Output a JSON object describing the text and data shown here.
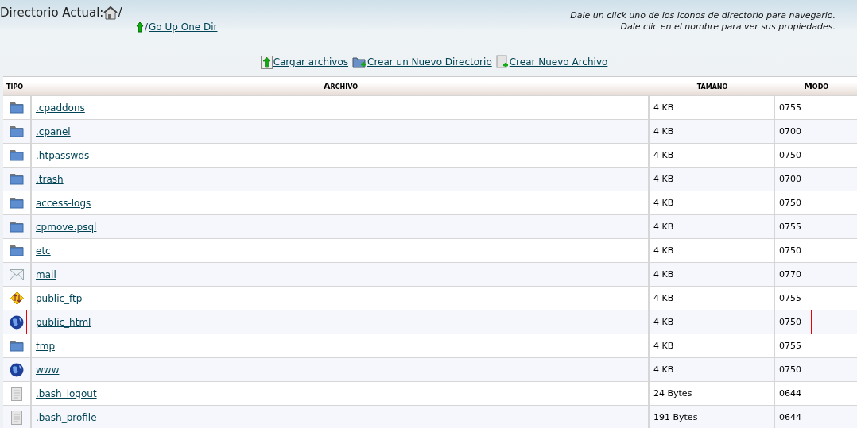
{
  "current_dir": {
    "label": "Directorio Actual:",
    "path": "/"
  },
  "go_up": {
    "separator": "/",
    "label": "Go Up One Dir"
  },
  "hints": [
    "Dale un click uno de los iconos de directorio para navegarlo.",
    "Dale clic en el nombre para ver sus propiedades."
  ],
  "actions": [
    {
      "kind": "upload",
      "label": "Cargar archivos"
    },
    {
      "kind": "newdir",
      "label": "Crear un Nuevo Directorio"
    },
    {
      "kind": "newfile",
      "label": "Crear Nuevo Archivo"
    }
  ],
  "table": {
    "columns": [
      "tipo",
      "Archivo",
      "tamaño",
      "Modo"
    ],
    "rows": [
      {
        "kind": "folder",
        "name": ".cpaddons",
        "size": "4 KB",
        "mode": "0755",
        "highlighted": false
      },
      {
        "kind": "folder",
        "name": ".cpanel",
        "size": "4 KB",
        "mode": "0700",
        "highlighted": false
      },
      {
        "kind": "folder",
        "name": ".htpasswds",
        "size": "4 KB",
        "mode": "0750",
        "highlighted": false
      },
      {
        "kind": "folder",
        "name": ".trash",
        "size": "4 KB",
        "mode": "0700",
        "highlighted": false
      },
      {
        "kind": "folder",
        "name": "access-logs",
        "size": "4 KB",
        "mode": "0750",
        "highlighted": false
      },
      {
        "kind": "folder",
        "name": "cpmove.psql",
        "size": "4 KB",
        "mode": "0755",
        "highlighted": false
      },
      {
        "kind": "folder",
        "name": "etc",
        "size": "4 KB",
        "mode": "0750",
        "highlighted": false
      },
      {
        "kind": "mail",
        "name": "mail",
        "size": "4 KB",
        "mode": "0770",
        "highlighted": false
      },
      {
        "kind": "ftp",
        "name": "public_ftp",
        "size": "4 KB",
        "mode": "0755",
        "highlighted": false
      },
      {
        "kind": "web",
        "name": "public_html",
        "size": "4 KB",
        "mode": "0750",
        "highlighted": true
      },
      {
        "kind": "folder",
        "name": "tmp",
        "size": "4 KB",
        "mode": "0755",
        "highlighted": false
      },
      {
        "kind": "web",
        "name": "www",
        "size": "4 KB",
        "mode": "0750",
        "highlighted": false
      },
      {
        "kind": "file",
        "name": ".bash_logout",
        "size": "24 Bytes",
        "mode": "0644",
        "highlighted": false
      },
      {
        "kind": "file",
        "name": ".bash_profile",
        "size": "191 Bytes",
        "mode": "0644",
        "highlighted": false
      }
    ]
  }
}
